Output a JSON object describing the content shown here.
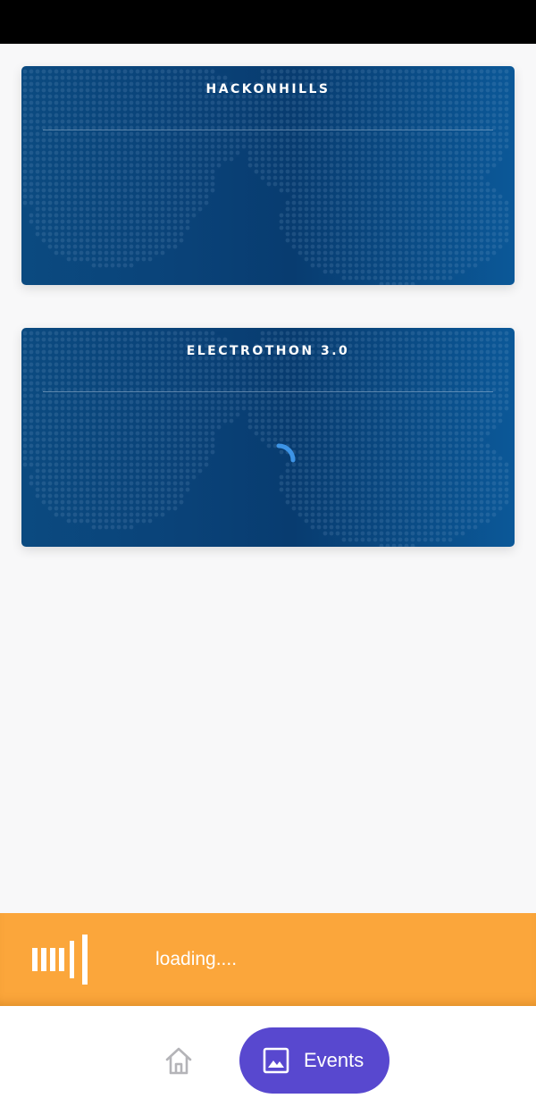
{
  "events": [
    {
      "title": "HACKONHILLS",
      "loading": false
    },
    {
      "title": "ELECTROTHON 3.0",
      "loading": true
    }
  ],
  "loading_bar": {
    "text": "loading....",
    "icon": "equalizer-bars-icon",
    "color": "#fba63b"
  },
  "bottom_nav": {
    "home_icon": "home-icon",
    "events_icon": "image-icon",
    "events_label": "Events",
    "active_color": "#5848cf"
  },
  "colors": {
    "card_blue": "#0a4379",
    "spinner": "#3d94e6"
  }
}
